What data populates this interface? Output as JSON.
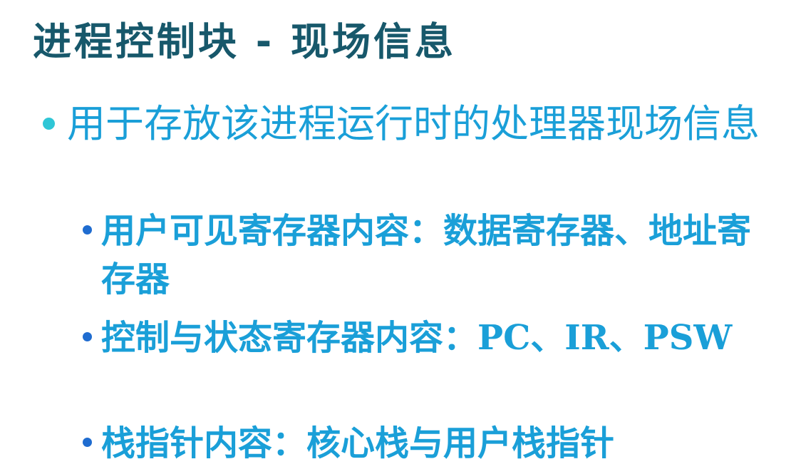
{
  "slide": {
    "title": "进程控制块 - 现场信息",
    "bullets": [
      {
        "level": 1,
        "text": "用于存放该进程运行时的处理器现场信息"
      },
      {
        "level": 2,
        "text": "用户可见寄存器内容：数据寄存器、地址寄存器"
      },
      {
        "level": 2,
        "text": "控制与状态寄存器内容：PC、IR、PSW"
      },
      {
        "level": 2,
        "text": "栈指针内容：核心栈与用户栈指针"
      }
    ]
  },
  "colors": {
    "title": "#17586b",
    "text": "#1a9fd8",
    "bullet_level1": "#2fc6d6",
    "bullet_level2": "#1f6cd0",
    "background": "#ffffff"
  }
}
